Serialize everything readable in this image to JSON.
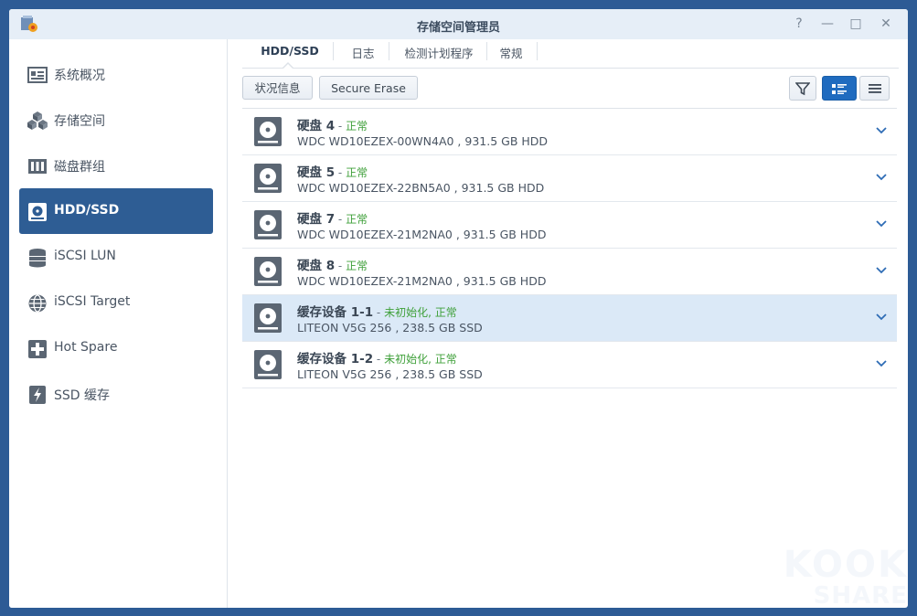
{
  "window": {
    "title": "存储空间管理员"
  },
  "controls": {
    "help": "?",
    "minimize": "—",
    "maximize": "□",
    "close": "✕"
  },
  "sidebar": {
    "items": [
      {
        "label": "系统概况",
        "icon": "overview-icon"
      },
      {
        "label": "存储空间",
        "icon": "storage-icon"
      },
      {
        "label": "磁盘群组",
        "icon": "disk-group-icon"
      },
      {
        "label": "HDD/SSD",
        "icon": "hdd-icon",
        "active": true
      },
      {
        "label": "iSCSI LUN",
        "icon": "lun-icon"
      },
      {
        "label": "iSCSI Target",
        "icon": "target-icon"
      },
      {
        "label": "Hot Spare",
        "icon": "hot-spare-icon"
      },
      {
        "label": "SSD 缓存",
        "icon": "ssd-cache-icon"
      }
    ]
  },
  "tabs": [
    {
      "label": "HDD/SSD",
      "active": true
    },
    {
      "label": "日志"
    },
    {
      "label": "检测计划程序"
    },
    {
      "label": "常规"
    }
  ],
  "toolbar": {
    "status_info": "状况信息",
    "secure_erase": "Secure Erase"
  },
  "disks": [
    {
      "name": "硬盘 4",
      "sep": " - ",
      "status": "正常",
      "model": "WDC WD10EZEX-00WN4A0 , 931.5 GB HDD"
    },
    {
      "name": "硬盘 5",
      "sep": " - ",
      "status": "正常",
      "model": "WDC WD10EZEX-22BN5A0 , 931.5 GB HDD"
    },
    {
      "name": "硬盘 7",
      "sep": " - ",
      "status": "正常",
      "model": "WDC WD10EZEX-21M2NA0 , 931.5 GB HDD"
    },
    {
      "name": "硬盘 8",
      "sep": " - ",
      "status": "正常",
      "model": "WDC WD10EZEX-21M2NA0 , 931.5 GB HDD"
    },
    {
      "name": "缓存设备 1-1",
      "sep": " - ",
      "status": "未初始化, 正常",
      "model": "LITEON V5G 256 , 238.5 GB SSD",
      "highlight": true
    },
    {
      "name": "缓存设备 1-2",
      "sep": " - ",
      "status": "未初始化, 正常",
      "model": "LITEON V5G 256 , 238.5 GB SSD"
    }
  ],
  "watermark": {
    "site": "koolshare.cn",
    "line1": "KOOK",
    "line2": "SHARE"
  },
  "colors": {
    "accent": "#2e5d94",
    "status_ok": "#3fa03a",
    "row_highlight": "#dbe9f7"
  }
}
